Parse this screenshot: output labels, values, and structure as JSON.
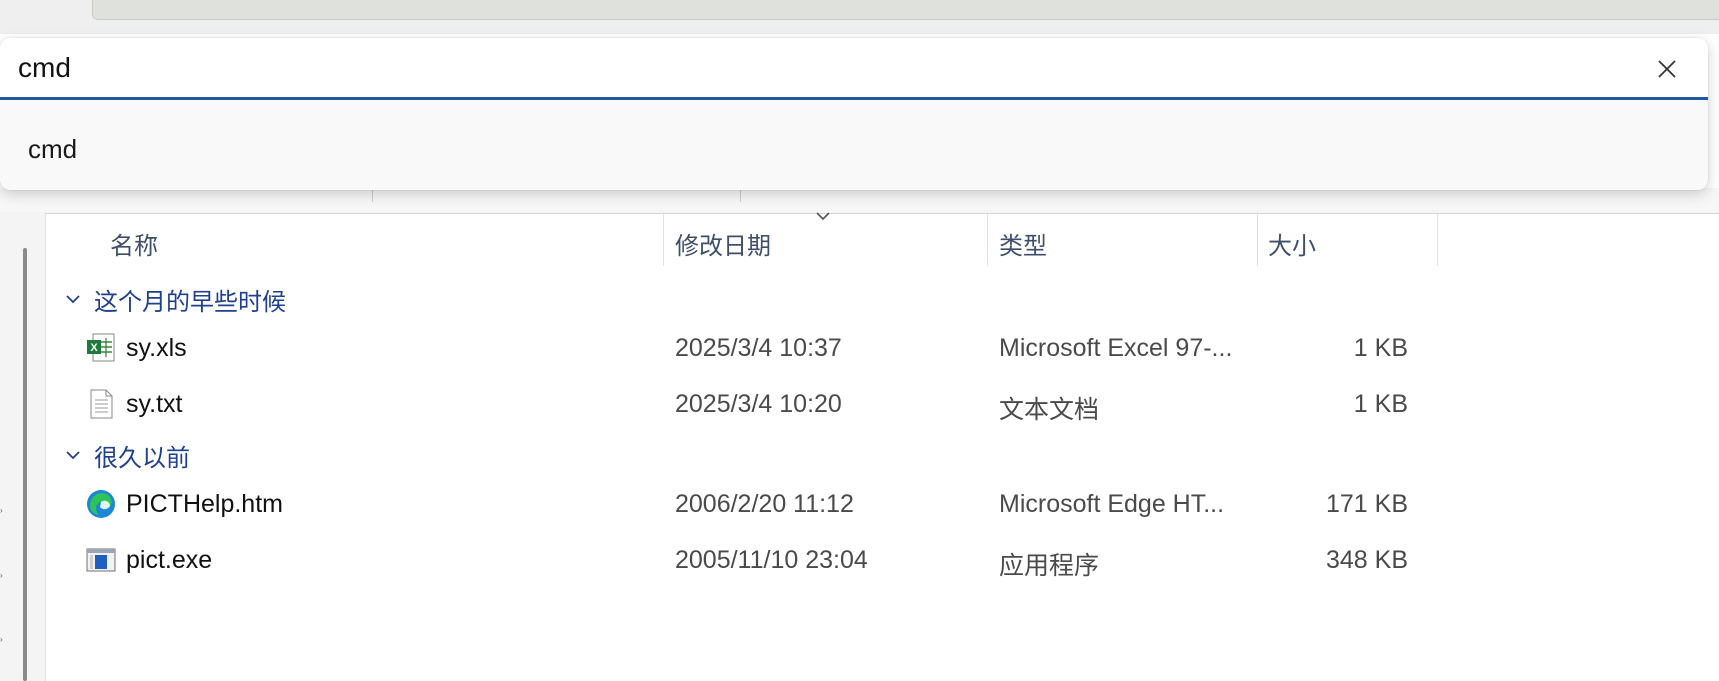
{
  "address_popup": {
    "input_value": "cmd",
    "suggestions": [
      "cmd"
    ]
  },
  "columns": {
    "name": "名称",
    "date_modified": "修改日期",
    "type": "类型",
    "size": "大小"
  },
  "groups": [
    {
      "label": "这个月的早些时候",
      "files": [
        {
          "name": "sy.xls",
          "date": "2025/3/4 10:37",
          "type": "Microsoft Excel 97-...",
          "size": "1 KB",
          "icon": "excel-file-icon"
        },
        {
          "name": "sy.txt",
          "date": "2025/3/4 10:20",
          "type": "文本文档",
          "size": "1 KB",
          "icon": "text-file-icon"
        }
      ]
    },
    {
      "label": "很久以前",
      "files": [
        {
          "name": "PICTHelp.htm",
          "date": "2006/2/20 11:12",
          "type": "Microsoft Edge HT...",
          "size": "171 KB",
          "icon": "edge-icon"
        },
        {
          "name": "pict.exe",
          "date": "2005/11/10 23:04",
          "type": "应用程序",
          "size": "348 KB",
          "icon": "application-icon"
        }
      ]
    }
  ],
  "colors": {
    "accent": "#1f5aa0",
    "group_header": "#1f3f8f",
    "header_text": "#3f4f6b"
  }
}
